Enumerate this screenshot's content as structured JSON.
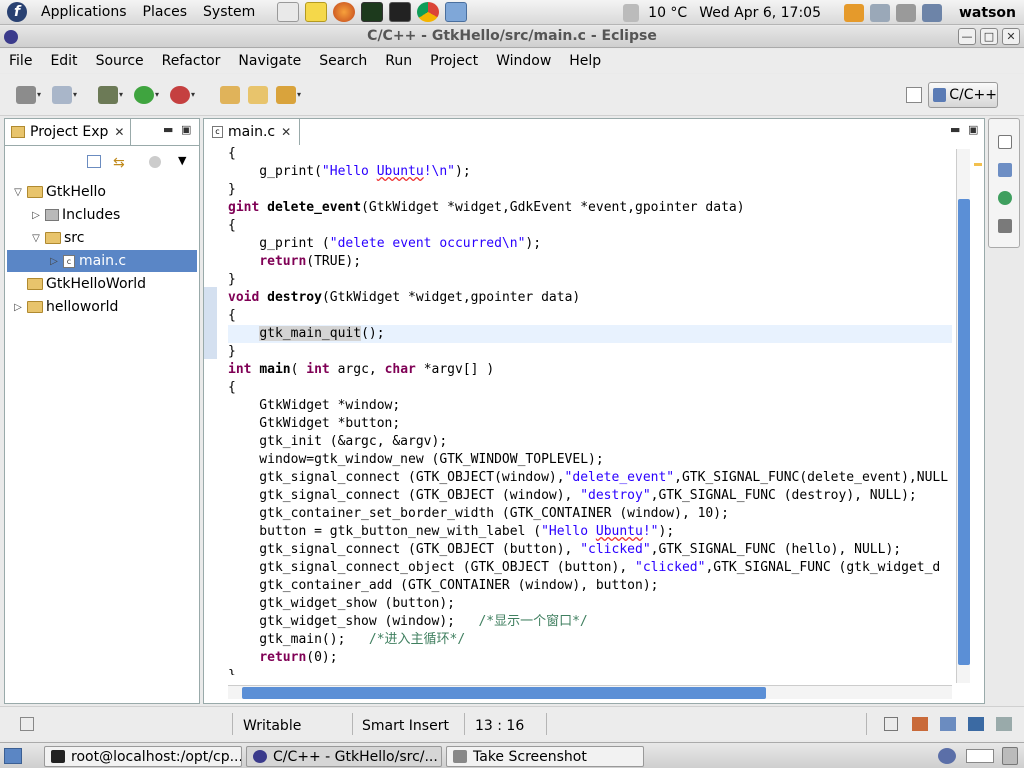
{
  "top_panel": {
    "menus": [
      "Applications",
      "Places",
      "System"
    ],
    "weather": "10 °C",
    "clock": "Wed Apr  6, 17:05",
    "user": "watson"
  },
  "window": {
    "title": "C/C++ - GtkHello/src/main.c - Eclipse"
  },
  "menubar": [
    "File",
    "Edit",
    "Source",
    "Refactor",
    "Navigate",
    "Search",
    "Run",
    "Project",
    "Window",
    "Help"
  ],
  "perspective": {
    "label": "C/C++"
  },
  "explorer": {
    "tab_label": "Project Exp",
    "tree": [
      {
        "label": "GtkHello",
        "indent": 0,
        "twisty": "▽",
        "icon": "project"
      },
      {
        "label": "Includes",
        "indent": 1,
        "twisty": "▷",
        "icon": "includes"
      },
      {
        "label": "src",
        "indent": 1,
        "twisty": "▽",
        "icon": "folder"
      },
      {
        "label": "main.c",
        "indent": 2,
        "twisty": "▷",
        "icon": "cfile",
        "selected": true
      },
      {
        "label": "GtkHelloWorld",
        "indent": 0,
        "twisty": "",
        "icon": "project"
      },
      {
        "label": "helloworld",
        "indent": 0,
        "twisty": "▷",
        "icon": "project"
      }
    ]
  },
  "editor": {
    "tab_label": "main.c",
    "lines": [
      "{",
      "    g_print(\"Hello Ubuntu!\\n\");",
      "}",
      "gint delete_event(GtkWidget *widget,GdkEvent *event,gpointer data)",
      "{",
      "    g_print (\"delete event occurred\\n\");",
      "    return(TRUE);",
      "}",
      "void destroy(GtkWidget *widget,gpointer data)",
      "{",
      "    gtk_main_quit();",
      "}",
      "int main( int argc, char *argv[] )",
      "{",
      "    GtkWidget *window;",
      "    GtkWidget *button;",
      "    gtk_init (&argc, &argv);",
      "    window=gtk_window_new (GTK_WINDOW_TOPLEVEL);",
      "    gtk_signal_connect (GTK_OBJECT(window),\"delete_event\",GTK_SIGNAL_FUNC(delete_event),NULL",
      "    gtk_signal_connect (GTK_OBJECT (window), \"destroy\",GTK_SIGNAL_FUNC (destroy), NULL);",
      "    gtk_container_set_border_width (GTK_CONTAINER (window), 10);",
      "    button = gtk_button_new_with_label (\"Hello Ubuntu!\");",
      "    gtk_signal_connect (GTK_OBJECT (button), \"clicked\",GTK_SIGNAL_FUNC (hello), NULL);",
      "    gtk_signal_connect_object (GTK_OBJECT (button), \"clicked\",GTK_SIGNAL_FUNC (gtk_widget_d",
      "    gtk_container_add (GTK_CONTAINER (window), button);",
      "    gtk_widget_show (button);",
      "    gtk_widget_show (window);   /*显示一个窗口*/",
      "    gtk_main();   /*进入主循环*/",
      "    return(0);",
      "}"
    ],
    "current_line_index": 10
  },
  "status": {
    "writable": "Writable",
    "insert_mode": "Smart Insert",
    "position": "13 : 16"
  },
  "taskbar": [
    {
      "label": "root@localhost:/opt/cp...",
      "icon": "terminal"
    },
    {
      "label": "C/C++ - GtkHello/src/...",
      "icon": "eclipse",
      "active": true
    },
    {
      "label": "Take Screenshot",
      "icon": "camera"
    }
  ],
  "colors": {
    "keyword": "#7f0055",
    "string": "#2a00ff",
    "comment": "#3f7f5f",
    "selection": "#5a86c6",
    "scroll_thumb": "#5b8fd6"
  }
}
